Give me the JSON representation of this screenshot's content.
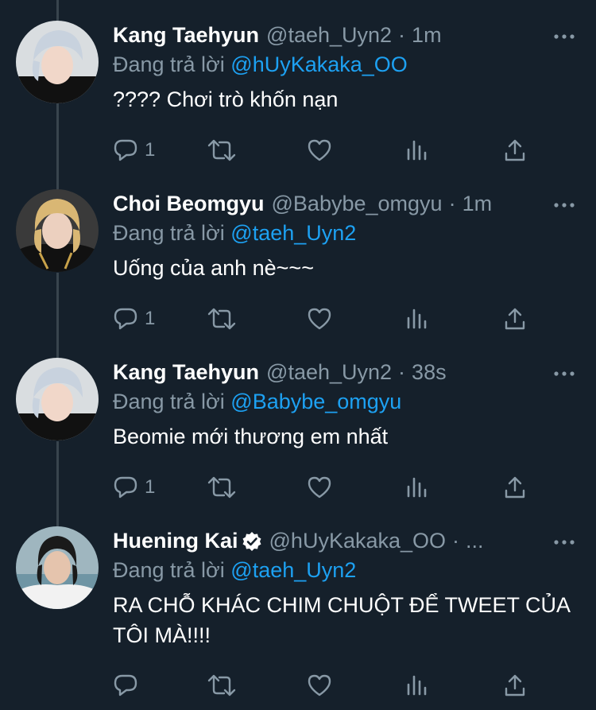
{
  "theme": {
    "background": "#15202b",
    "text": "#ffffff",
    "muted": "#8899a6",
    "link": "#1da1f2",
    "thread_line": "#38444d"
  },
  "tweets": [
    {
      "name": "Kang Taehyun",
      "handle": "@taeh_Uyn2",
      "separator": "·",
      "time": "1m",
      "replying_label": "Đang trả lời",
      "replying_to": "@hUyKakaka_OO",
      "text": "???? Chơi trò khốn nạn",
      "reply_count": "1",
      "verified": false,
      "avatar_icon": "silver-hair-avatar-icon"
    },
    {
      "name": "Choi Beomgyu",
      "handle": "@Babybe_omgyu",
      "separator": "·",
      "time": "1m",
      "replying_label": "Đang trả lời",
      "replying_to": "@taeh_Uyn2",
      "text": "Uống của anh nè~~~",
      "reply_count": "1",
      "verified": false,
      "avatar_icon": "blonde-hair-avatar-icon"
    },
    {
      "name": "Kang Taehyun",
      "handle": "@taeh_Uyn2",
      "separator": "·",
      "time": "38s",
      "replying_label": "Đang trả lời",
      "replying_to": "@Babybe_omgyu",
      "text": "Beomie mới thương em nhất",
      "reply_count": "1",
      "verified": false,
      "avatar_icon": "silver-hair-avatar-icon"
    },
    {
      "name": "Huening Kai",
      "handle": "@hUyKakaka_OO",
      "separator": "·",
      "time": "...",
      "replying_label": "Đang trả lời",
      "replying_to": "@taeh_Uyn2",
      "text": "RA CHỖ KHÁC CHIM CHUỘT ĐỂ TWEET CỦA TÔI MÀ!!!!",
      "reply_count": "",
      "verified": true,
      "avatar_icon": "dark-hair-avatar-icon"
    }
  ]
}
